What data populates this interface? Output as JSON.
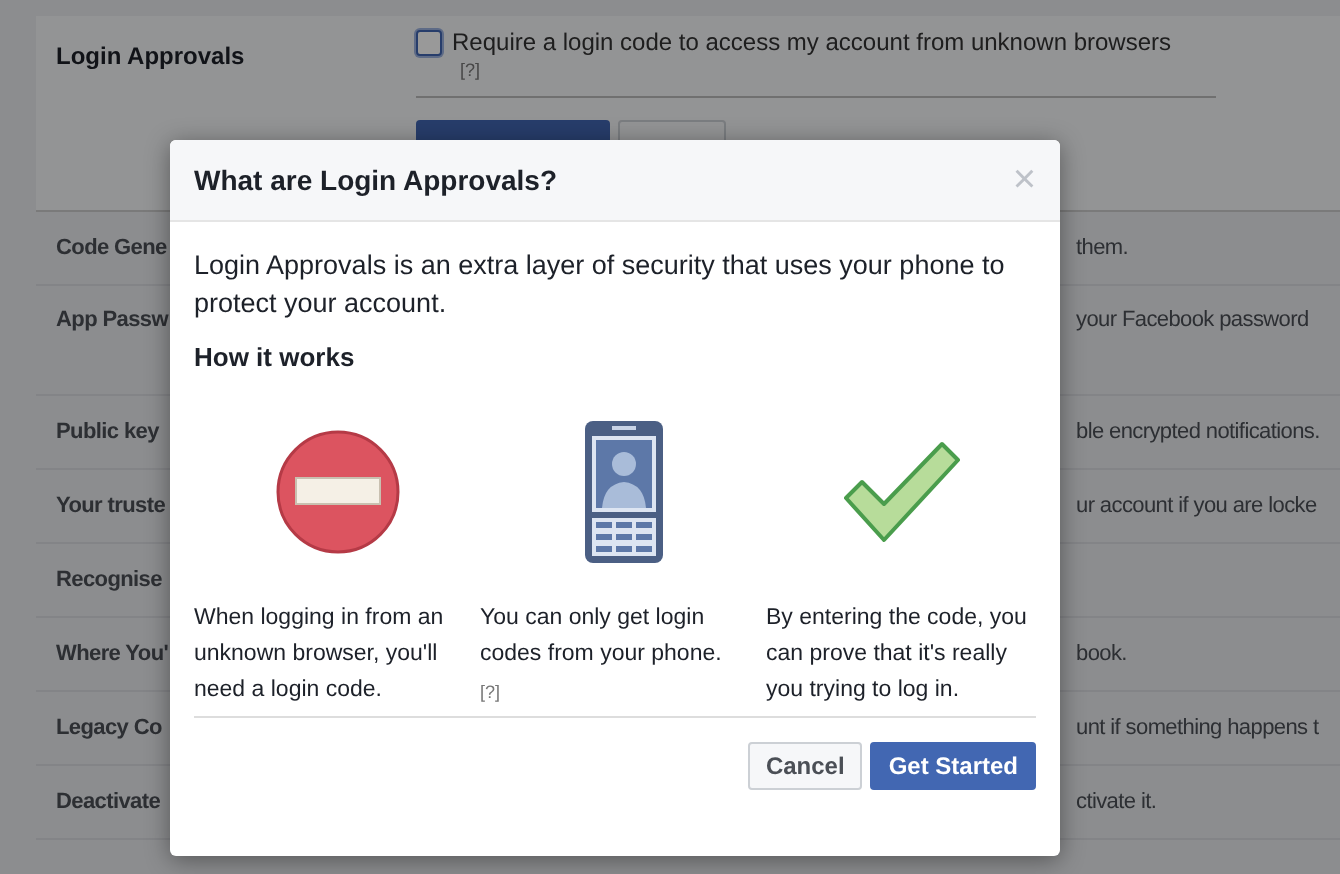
{
  "login_approvals": {
    "label": "Login Approvals",
    "checkbox": {
      "label": "Require a login code to access my account from unknown browsers",
      "checked": false
    },
    "help": "[?]"
  },
  "settings_rows": [
    {
      "label": "Code Gene",
      "description": "them."
    },
    {
      "label": "App Passw",
      "description": "your Facebook password"
    },
    {
      "label": "Public key",
      "description": "ble encrypted notifications."
    },
    {
      "label": "Your truste",
      "description": "ur account if you are locke"
    },
    {
      "label": "Recognise",
      "description": ""
    },
    {
      "label": "Where You'",
      "description": "book."
    },
    {
      "label": "Legacy Co",
      "description": "unt if something happens t"
    },
    {
      "label": "Deactivate",
      "description": "ctivate it."
    }
  ],
  "dialog": {
    "title": "What are Login Approvals?",
    "close": "×",
    "intro": "Login Approvals is an extra layer of security that uses your phone to protect your account.",
    "subheading": "How it works",
    "steps": [
      {
        "kind": "stop",
        "text": "When logging in from an unknown browser, you'll need a login code."
      },
      {
        "kind": "phone",
        "text": "You can only get login codes from your phone.",
        "help": "[?]"
      },
      {
        "kind": "check",
        "text": "By entering the code, you can prove that it's really you trying to log in."
      }
    ],
    "buttons": [
      {
        "label": "Cancel",
        "primary": false
      },
      {
        "label": "Get Started",
        "primary": true
      }
    ]
  }
}
